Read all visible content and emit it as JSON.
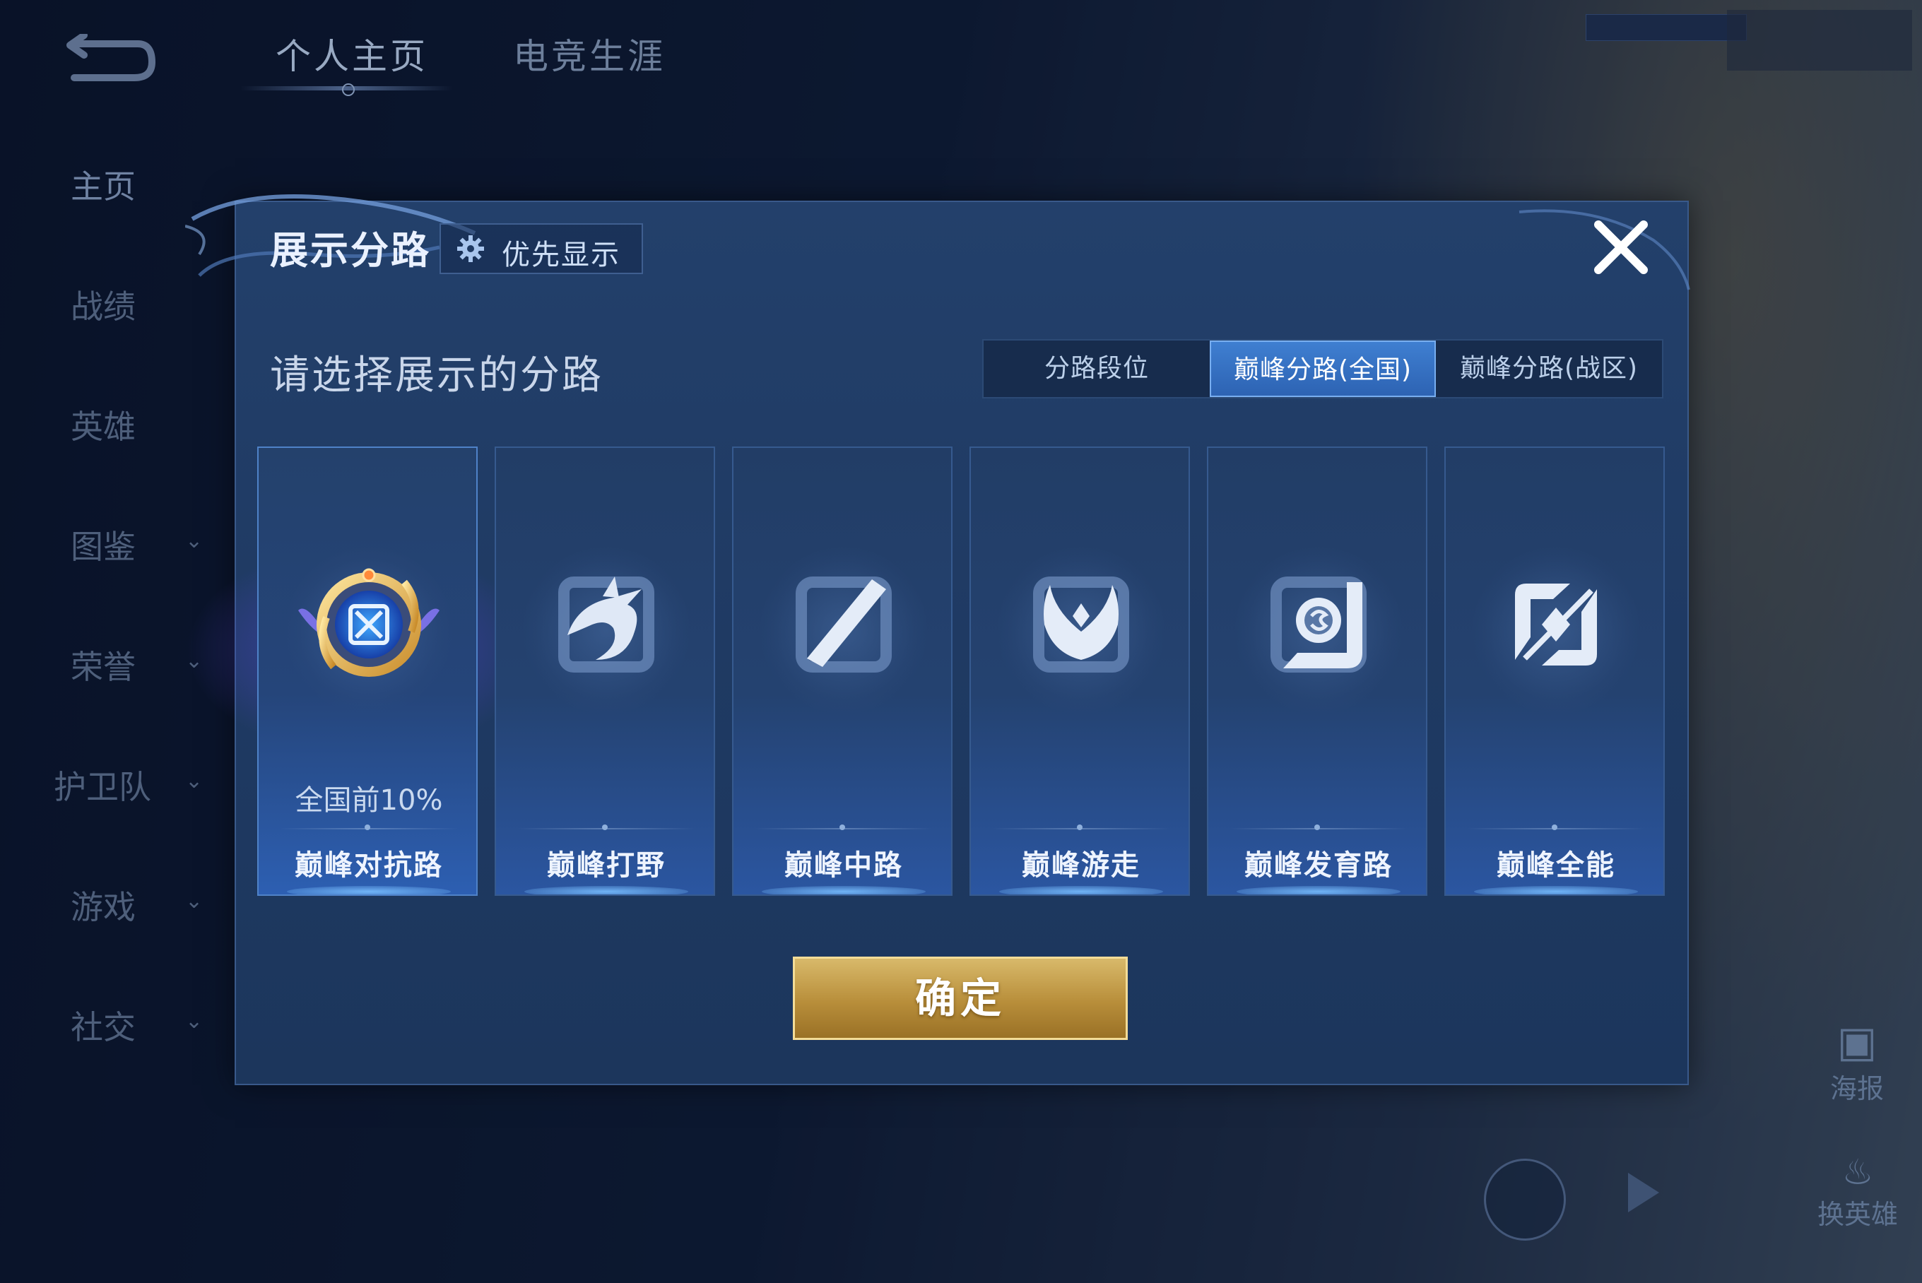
{
  "nav": {
    "tabs": [
      {
        "label": "个人主页",
        "active": true
      },
      {
        "label": "电竞生涯",
        "active": false
      }
    ]
  },
  "sidebar": {
    "items": [
      {
        "label": "主页",
        "active": true
      },
      {
        "label": "战绩"
      },
      {
        "label": "英雄"
      },
      {
        "label": "图鉴",
        "has_chevron": true
      },
      {
        "label": "荣誉",
        "has_chevron": true
      },
      {
        "label": "护卫队",
        "has_chevron": true
      },
      {
        "label": "游戏",
        "has_chevron": true
      },
      {
        "label": "社交",
        "has_chevron": true
      }
    ]
  },
  "right_controls": {
    "poster_label": "海报",
    "swap_label": "换英雄"
  },
  "dialog": {
    "title": "展示分路",
    "priority_button": "优先显示",
    "subtitle": "请选择展示的分路",
    "segments": [
      {
        "label": "分路段位",
        "active": false
      },
      {
        "label": "巅峰分路(全国)",
        "active": true
      },
      {
        "label": "巅峰分路(战区)",
        "active": false
      }
    ],
    "roles": [
      {
        "name": "巅峰对抗路",
        "rank": "全国前10%",
        "selected": true,
        "icon": "clash-lane-emblem-icon"
      },
      {
        "name": "巅峰打野",
        "rank": "",
        "selected": false,
        "icon": "jungle-dragon-icon"
      },
      {
        "name": "巅峰中路",
        "rank": "",
        "selected": false,
        "icon": "mid-lane-slash-icon"
      },
      {
        "name": "巅峰游走",
        "rank": "",
        "selected": false,
        "icon": "roam-wings-icon"
      },
      {
        "name": "巅峰发育路",
        "rank": "",
        "selected": false,
        "icon": "farm-lane-icon"
      },
      {
        "name": "巅峰全能",
        "rank": "",
        "selected": false,
        "icon": "all-round-icon"
      }
    ],
    "confirm_button": "确定"
  },
  "colors": {
    "accent_blue": "#2d63b3",
    "gold_button": "#b88e3a",
    "dialog_bg": "#1f3a63"
  }
}
